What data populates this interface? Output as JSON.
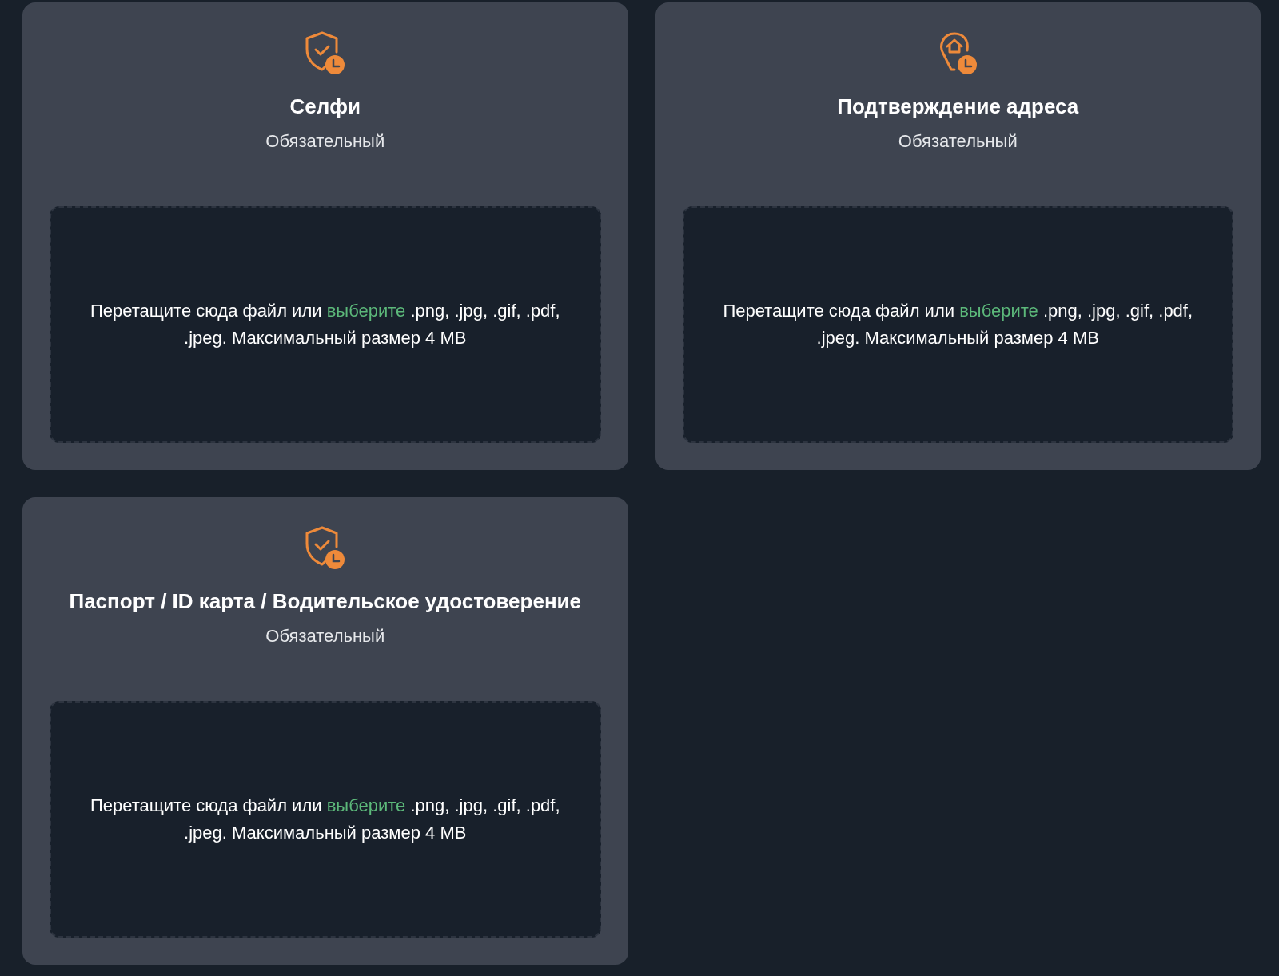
{
  "documents": [
    {
      "kind": "shield",
      "title": "Селфи",
      "subtitle": "Обязательный",
      "dropzone": {
        "before": "Перетащите сюда файл или",
        "link": "выберите",
        "after": ".png, .jpg, .gif, .pdf, .jpeg. Максимальный размер 4 MB"
      }
    },
    {
      "kind": "home-pin",
      "title": "Подтверждение адреса",
      "subtitle": "Обязательный",
      "dropzone": {
        "before": "Перетащите сюда файл или",
        "link": "выберите",
        "after": ".png, .jpg, .gif, .pdf, .jpeg. Максимальный размер 4 MB"
      }
    },
    {
      "kind": "shield",
      "title": "Паспорт / ID карта / Водительское удостоверение",
      "subtitle": "Обязательный",
      "dropzone": {
        "before": "Перетащите сюда файл или",
        "link": "выберите",
        "after": ".png, .jpg, .gif, .pdf, .jpeg. Максимальный размер 4 MB"
      }
    }
  ]
}
